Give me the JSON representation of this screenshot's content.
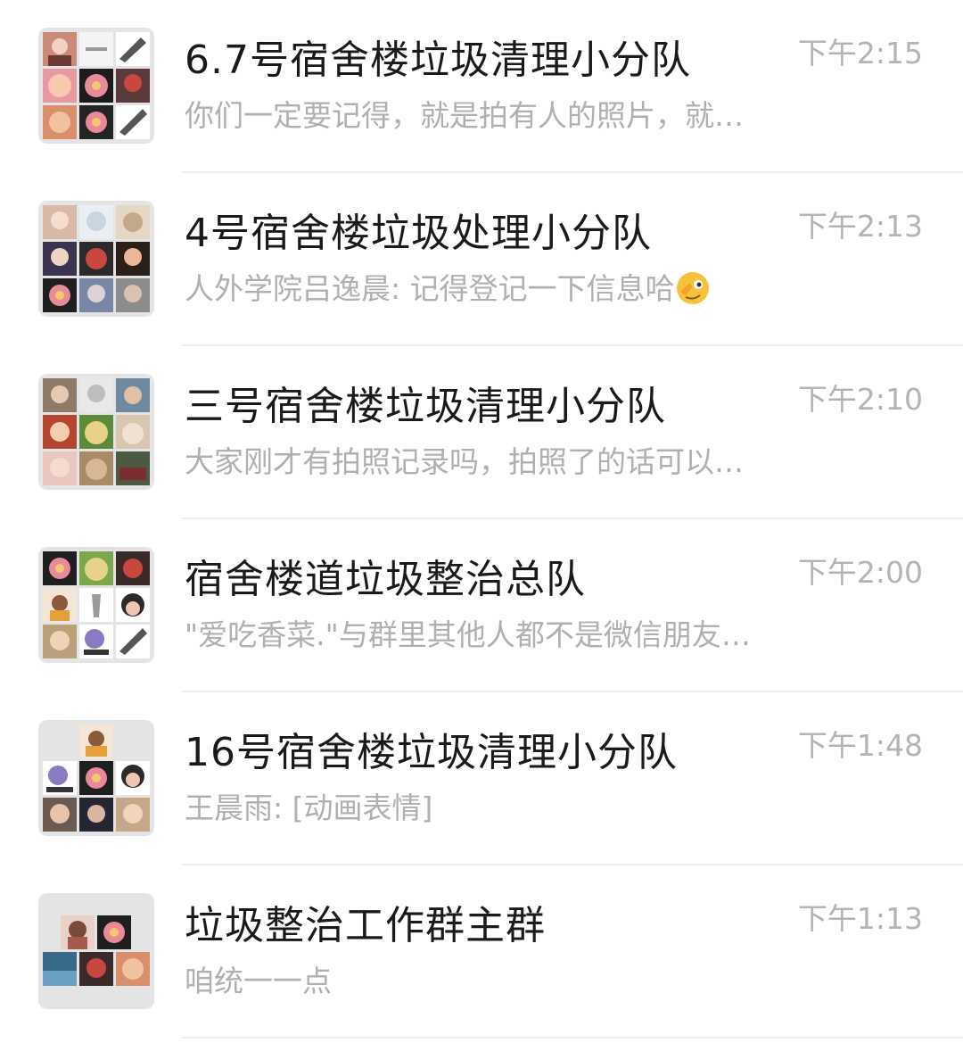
{
  "chats": [
    {
      "title": "6.7号宿舍楼垃圾清理小分队",
      "time": "下午2:15",
      "preview": "你们一定要记得，就是拍有人的照片，就…",
      "avatar_grid": 3
    },
    {
      "title": "4号宿舍楼垃圾处理小分队",
      "time": "下午2:13",
      "preview": "人外学院吕逸晨: 记得登记一下信息哈",
      "preview_emoji": "face-emoji-icon",
      "avatar_grid": 3
    },
    {
      "title": "三号宿舍楼垃圾清理小分队",
      "time": "下午2:10",
      "preview": "大家刚才有拍照记录吗，拍照了的话可以…",
      "avatar_grid": 3
    },
    {
      "title": "宿舍楼道垃圾整治总队",
      "time": "下午2:00",
      "preview": "\"爱吃香菜.\"与群里其他人都不是微信朋友…",
      "avatar_grid": 3
    },
    {
      "title": "16号宿舍楼垃圾清理小分队",
      "time": "下午1:48",
      "preview": "王晨雨: [动画表情]",
      "avatar_grid": 3
    },
    {
      "title": "垃圾整治工作群主群",
      "time": "下午1:13",
      "preview": "咱统一一点",
      "avatar_grid": 2
    }
  ],
  "colors": {
    "title": "#1a1a1a",
    "time": "#b4b4b4",
    "preview": "#b0b0b0",
    "avatar_bg": "#e4e4e4",
    "divider": "#ededed"
  }
}
